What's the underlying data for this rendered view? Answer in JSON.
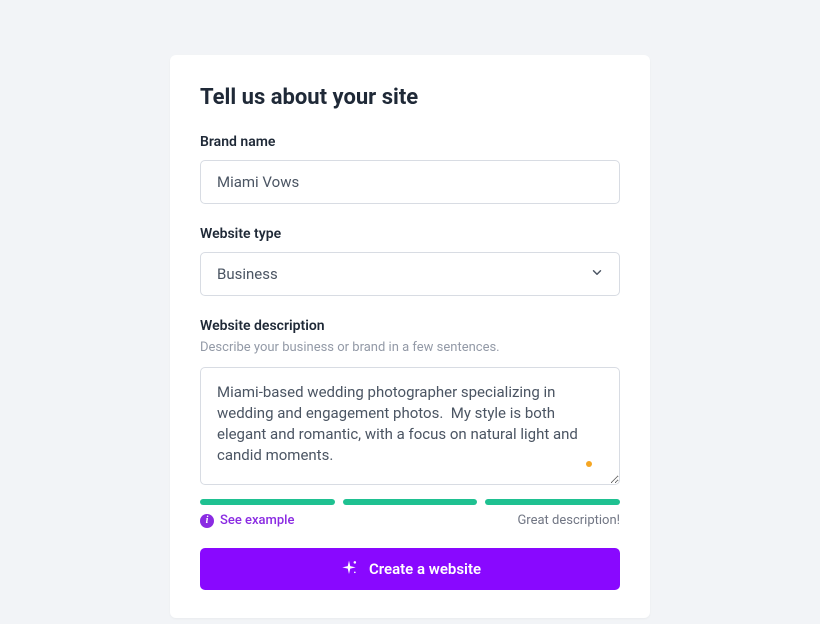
{
  "page": {
    "title": "Tell us about your site"
  },
  "brand": {
    "label": "Brand name",
    "value": "Miami Vows"
  },
  "websiteType": {
    "label": "Website type",
    "value": "Business"
  },
  "description": {
    "label": "Website description",
    "hint": "Describe your business or brand in a few sentences.",
    "value": "Miami-based wedding photographer specializing in wedding and engagement photos.  My style is both elegant and romantic, with a focus on natural light and candid moments."
  },
  "feedback": {
    "seeExample": "See example",
    "message": "Great description!"
  },
  "button": {
    "label": "Create a website"
  }
}
